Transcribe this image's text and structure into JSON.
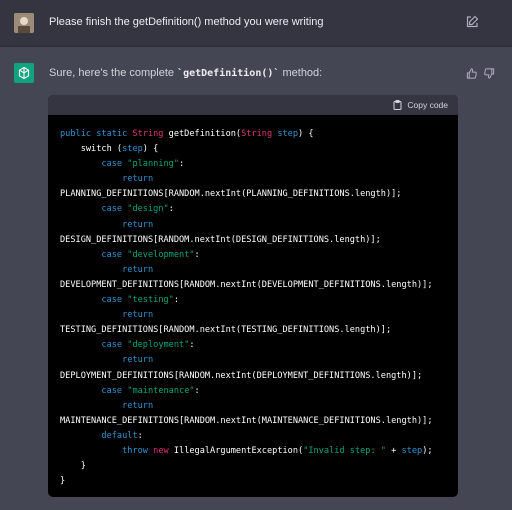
{
  "user": {
    "message": "Please finish the getDefinition() method you were writing"
  },
  "assistant": {
    "intro_prefix": "Sure, here's the complete ",
    "intro_code": "`getDefinition()`",
    "intro_suffix": " method:"
  },
  "code_block": {
    "copy_label": "Copy code",
    "lines": [
      [
        [
          "kw",
          "public static "
        ],
        [
          "ty",
          "String "
        ],
        [
          "plain",
          "getDefinition("
        ],
        [
          "ty",
          "String "
        ],
        [
          "kw",
          "step"
        ],
        [
          "plain",
          ") {"
        ]
      ],
      [
        [
          "plain",
          "    switch ("
        ],
        [
          "kw",
          "step"
        ],
        [
          "plain",
          ") {"
        ]
      ],
      [
        [
          "plain",
          "        "
        ],
        [
          "kw",
          "case "
        ],
        [
          "st",
          "\"planning\""
        ],
        [
          "plain",
          ":"
        ]
      ],
      [
        [
          "plain",
          "            "
        ],
        [
          "kw",
          "return"
        ]
      ],
      [
        [
          "plain",
          "PLANNING_DEFINITIONS[RANDOM.nextInt(PLANNING_DEFINITIONS.length)];"
        ]
      ],
      [
        [
          "plain",
          "        "
        ],
        [
          "kw",
          "case "
        ],
        [
          "st",
          "\"design\""
        ],
        [
          "plain",
          ":"
        ]
      ],
      [
        [
          "plain",
          "            "
        ],
        [
          "kw",
          "return"
        ]
      ],
      [
        [
          "plain",
          "DESIGN_DEFINITIONS[RANDOM.nextInt(DESIGN_DEFINITIONS.length)];"
        ]
      ],
      [
        [
          "plain",
          "        "
        ],
        [
          "kw",
          "case "
        ],
        [
          "st",
          "\"development\""
        ],
        [
          "plain",
          ":"
        ]
      ],
      [
        [
          "plain",
          "            "
        ],
        [
          "kw",
          "return"
        ]
      ],
      [
        [
          "plain",
          "DEVELOPMENT_DEFINITIONS[RANDOM.nextInt(DEVELOPMENT_DEFINITIONS.length)];"
        ]
      ],
      [
        [
          "plain",
          "        "
        ],
        [
          "kw",
          "case "
        ],
        [
          "st",
          "\"testing\""
        ],
        [
          "plain",
          ":"
        ]
      ],
      [
        [
          "plain",
          "            "
        ],
        [
          "kw",
          "return"
        ]
      ],
      [
        [
          "plain",
          "TESTING_DEFINITIONS[RANDOM.nextInt(TESTING_DEFINITIONS.length)];"
        ]
      ],
      [
        [
          "plain",
          "        "
        ],
        [
          "kw",
          "case "
        ],
        [
          "st",
          "\"deployment\""
        ],
        [
          "plain",
          ":"
        ]
      ],
      [
        [
          "plain",
          "            "
        ],
        [
          "kw",
          "return"
        ]
      ],
      [
        [
          "plain",
          "DEPLOYMENT_DEFINITIONS[RANDOM.nextInt(DEPLOYMENT_DEFINITIONS.length)];"
        ]
      ],
      [
        [
          "plain",
          "        "
        ],
        [
          "kw",
          "case "
        ],
        [
          "st",
          "\"maintenance\""
        ],
        [
          "plain",
          ":"
        ]
      ],
      [
        [
          "plain",
          "            "
        ],
        [
          "kw",
          "return"
        ]
      ],
      [
        [
          "plain",
          "MAINTENANCE_DEFINITIONS[RANDOM.nextInt(MAINTENANCE_DEFINITIONS.length)];"
        ]
      ],
      [
        [
          "plain",
          "        "
        ],
        [
          "kw",
          "default"
        ],
        [
          "plain",
          ":"
        ]
      ],
      [
        [
          "plain",
          "            "
        ],
        [
          "kw",
          "throw "
        ],
        [
          "ty",
          "new "
        ],
        [
          "plain",
          "IllegalArgumentException("
        ],
        [
          "st",
          "\"Invalid step: \""
        ],
        [
          "plain",
          " + "
        ],
        [
          "kw",
          "step"
        ],
        [
          "plain",
          ");"
        ]
      ],
      [
        [
          "plain",
          "    }"
        ]
      ],
      [
        [
          "plain",
          "}"
        ]
      ]
    ]
  },
  "colors": {
    "keyword": "#2e95d3",
    "type": "#df3079",
    "string": "#00a67d",
    "assistant_avatar": "#10a37f"
  },
  "icons": [
    "user-avatar",
    "edit-icon",
    "openai-logo-icon",
    "thumbs-up-icon",
    "thumbs-down-icon",
    "clipboard-icon"
  ]
}
